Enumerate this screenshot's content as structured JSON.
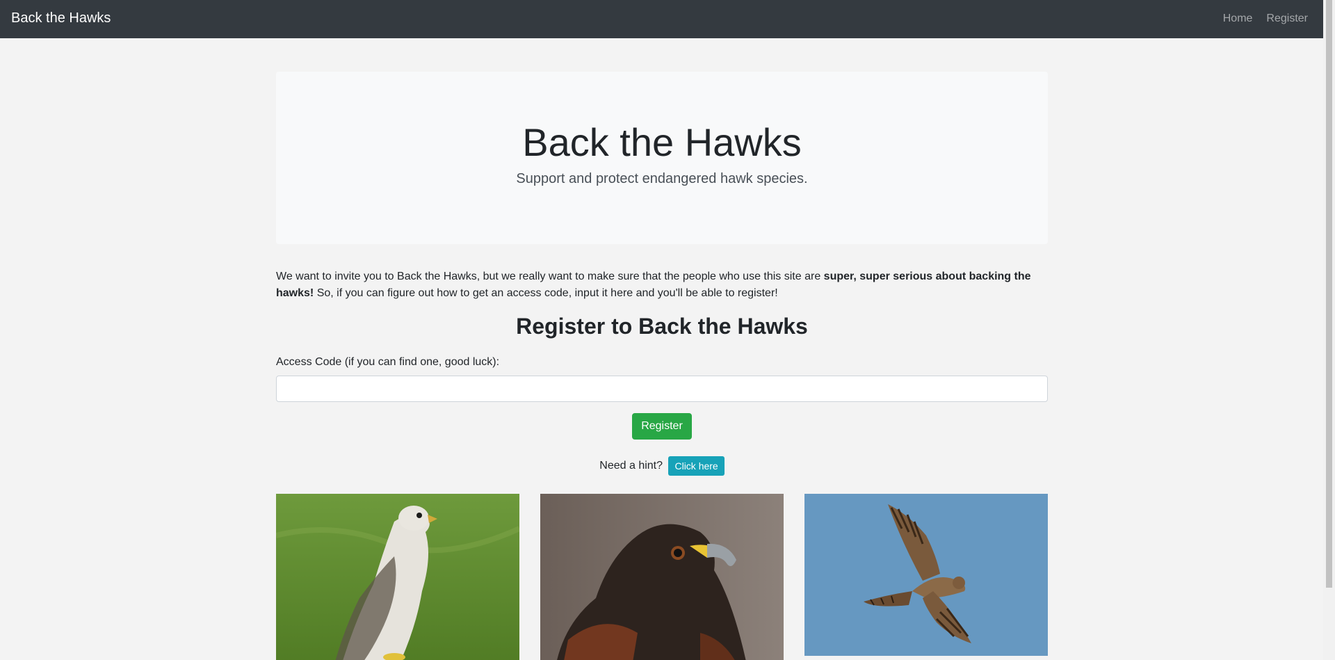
{
  "nav": {
    "brand": "Back the Hawks",
    "links": [
      {
        "label": "Home"
      },
      {
        "label": "Register"
      }
    ]
  },
  "hero": {
    "title": "Back the Hawks",
    "subtitle": "Support and protect endangered hawk species."
  },
  "intro": {
    "part1": "We want to invite you to Back the Hawks, but we really want to make sure that the people who use this site are ",
    "emphasis": "super, super serious about backing the hawks!",
    "part2": " So, if you can figure out how to get an access code, input it here and you'll be able to register!"
  },
  "form": {
    "title": "Register to Back the Hawks",
    "label": "Access Code (if you can find one, good luck):",
    "value": "",
    "submit_label": "Register"
  },
  "hint": {
    "text": "Need a hint?",
    "button_label": "Click here"
  },
  "colors": {
    "navbar": "#343a40",
    "success": "#28a745",
    "info": "#17a2b8",
    "sky": "#6698c1"
  }
}
